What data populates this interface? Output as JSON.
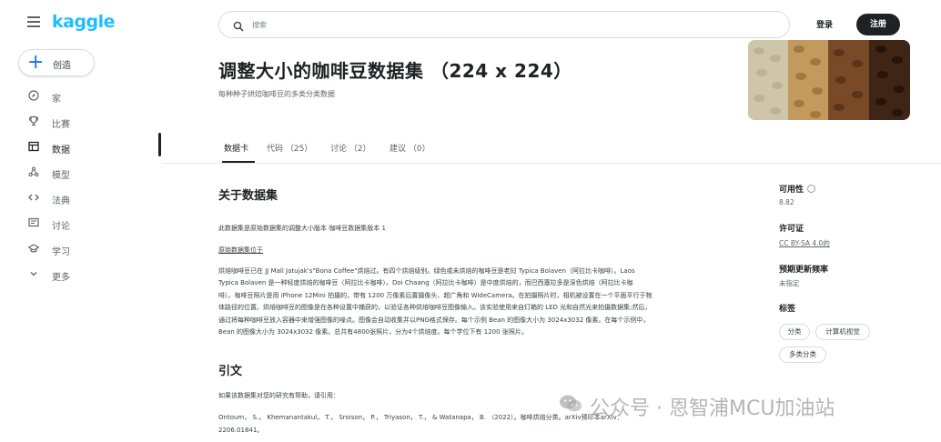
{
  "brand": {
    "logo": "kaggle",
    "accent": "#20beff"
  },
  "sidebar": {
    "create_label": "创造",
    "items": [
      {
        "label": "家",
        "icon": "compass-icon"
      },
      {
        "label": "比赛",
        "icon": "trophy-icon"
      },
      {
        "label": "数据",
        "icon": "table-icon",
        "active": true
      },
      {
        "label": "模型",
        "icon": "models-icon"
      },
      {
        "label": "法典",
        "icon": "code-icon"
      },
      {
        "label": "讨论",
        "icon": "discussion-icon"
      },
      {
        "label": "学习",
        "icon": "learn-icon"
      },
      {
        "label": "更多",
        "icon": "chevron-down-icon"
      }
    ]
  },
  "topbar": {
    "search_placeholder": "搜索",
    "login_label": "登录",
    "register_label": "注册"
  },
  "header": {
    "title": "调整大小的咖啡豆数据集 （224 x 224）",
    "subtitle": "每种种子烘焙咖啡豆的多类分类数据"
  },
  "tabs": [
    {
      "label": "数据卡",
      "active": true
    },
    {
      "label": "代码 （25）"
    },
    {
      "label": "讨论 （2）"
    },
    {
      "label": "建议 （0）"
    }
  ],
  "main": {
    "about_heading": "关于数据集",
    "intro": "此数据集是原始数据集的调整大小版本 咖啡豆数据集版本 1",
    "original_link": "原始数据集位于",
    "body_lines": [
      "烘焙咖啡豆已在 JJ Mall Jatujak's\"Bona Coffee\"烘焙过。有四个烘焙级别。绿色或未烘焙的咖啡豆是老挝 Typica Bolaven（阿拉比卡咖啡）。Laos",
      "Typica Bolaven 是一种轻度烘焙的咖啡豆（阿拉比卡咖啡）。Doi Chaang（阿拉比卡咖啡）是中度烘焙的，而巴西塞拉多是深色烘焙（阿拉比卡咖",
      "啡）。咖啡豆照片是用 iPhone 12Mini 拍摄的，带有 1200 万像素后置摄像头、超广角和 WideCamera。在拍摄照片时，相机被设置在一个平面平行于物",
      "体路径的位置。烘焙咖啡豆的图像是在各种设置中捕获的，以验证各种烘焙咖啡豆图像输入。该实验使用来自灯箱的 LED 光和自然光来拍摄数据集;然后，",
      "通过将每种咖啡豆放入容器中来增强图像的噪点。图像会自动收集并以PNG格式保存。每个示例 Bean 的图像大小为 3024x3032 像素。在每个示例中，",
      "Bean 的图像大小为 3024x3032 像素。总共有4800张照片，分为4个烘焙度。每个学位下有 1200 张照片。"
    ],
    "citation_heading": "引文",
    "citation_intro": "如果该数据集对您的研究有帮助，请引用：",
    "citation_lines": [
      "Ontoum， S.， Khemanantakul， T.， Sroison， P.， Triyason， T.， & Watanapa， B. （2022）。咖啡烘焙分类。arXiv预印本arXiv：",
      "2206.01841。"
    ]
  },
  "sidebar_right": {
    "usability_label": "可用性",
    "usability_value": "8.82",
    "license_label": "许可证",
    "license_value": "CC BY-SA 4.0的",
    "frequency_label": "预期更新频率",
    "frequency_value": "未指定",
    "tags_label": "标签",
    "tags": [
      "分类",
      "计算机视觉",
      "多类分类"
    ]
  },
  "watermark": {
    "text": "公众号 · 恩智浦MCU加油站"
  }
}
